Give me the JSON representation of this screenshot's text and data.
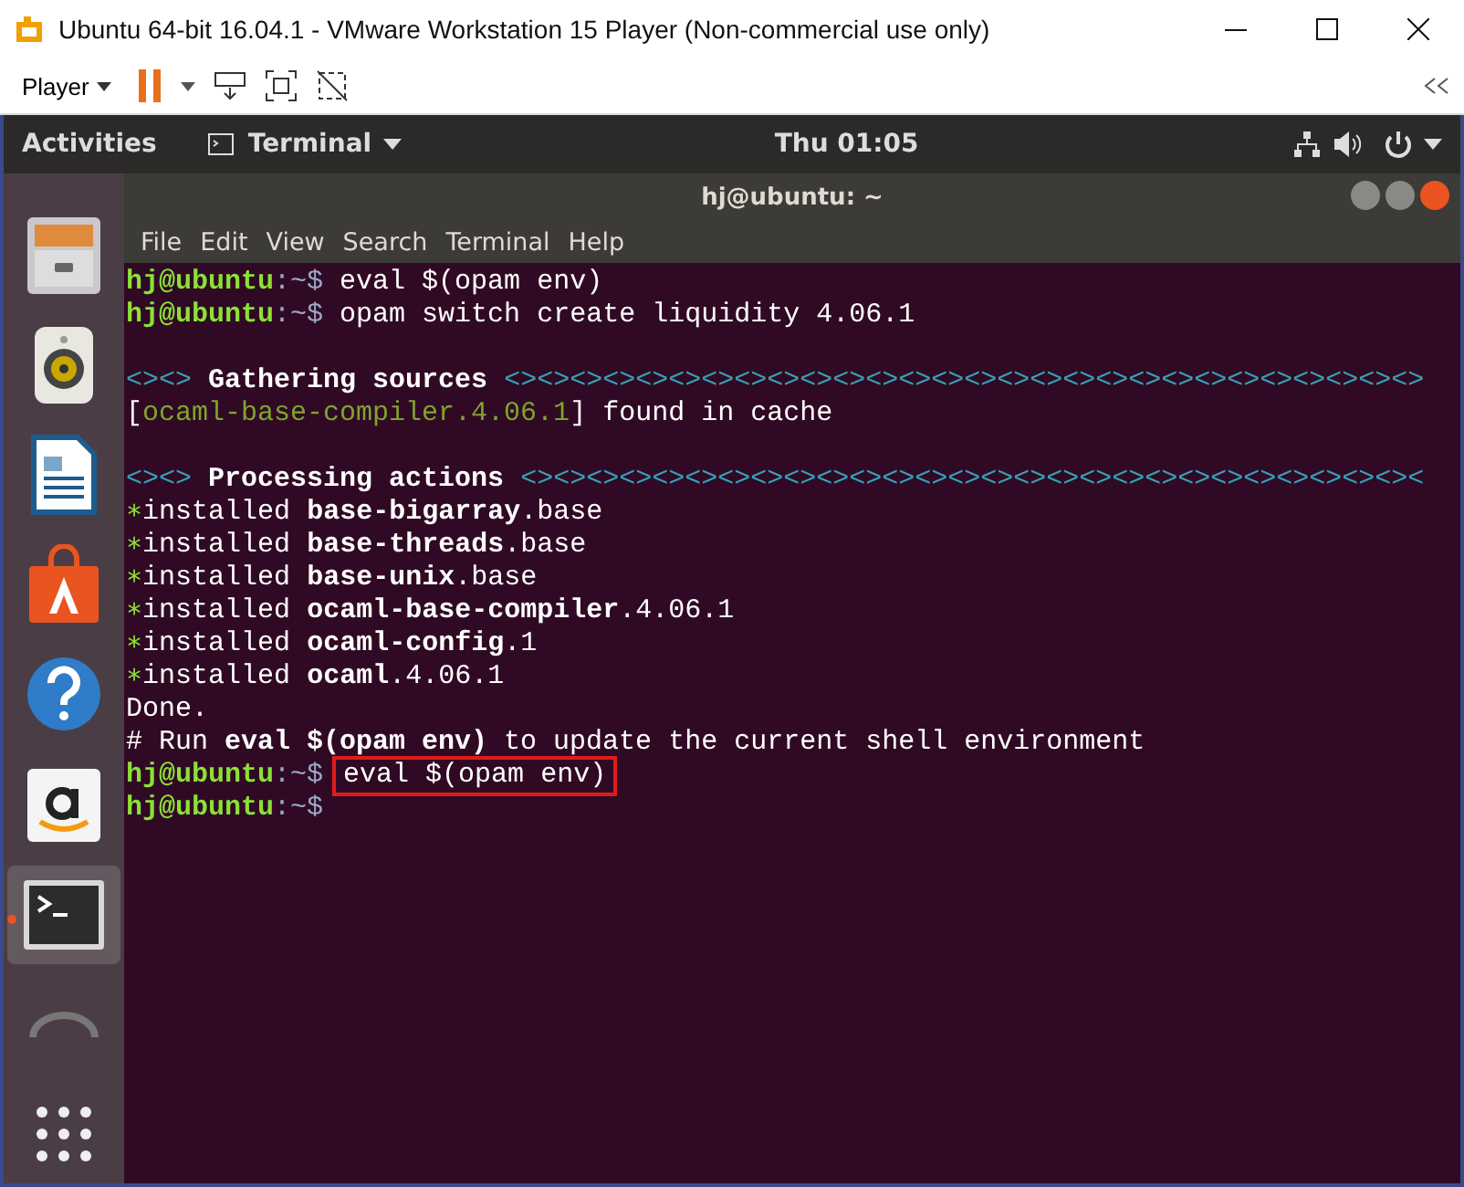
{
  "window": {
    "title": "Ubuntu 64-bit 16.04.1 - VMware Workstation 15 Player (Non-commercial use only)"
  },
  "toolbar": {
    "menu": "Player"
  },
  "topbar": {
    "activities": "Activities",
    "app": "Terminal",
    "clock": "Thu 01:05"
  },
  "dock": [
    {
      "kind": "files",
      "active": false
    },
    {
      "kind": "speaker",
      "active": false
    },
    {
      "kind": "writer",
      "active": false
    },
    {
      "kind": "software",
      "active": false
    },
    {
      "kind": "help",
      "active": false
    },
    {
      "kind": "amazon",
      "active": false
    },
    {
      "kind": "terminal",
      "active": true
    },
    {
      "kind": "partial",
      "active": false
    },
    {
      "kind": "grid",
      "active": false
    }
  ],
  "terminal": {
    "title": "hj@ubuntu: ~",
    "menu": [
      "File",
      "Edit",
      "View",
      "Search",
      "Terminal",
      "Help"
    ],
    "lines": [
      {
        "kind": "prompt",
        "user": "hj@ubuntu",
        "path": ":~$",
        "command": "eval $(opam env)",
        "highlighted": false
      },
      {
        "kind": "prompt",
        "user": "hj@ubuntu",
        "path": ":~$",
        "command": "opam switch create liquidity 4.06.1",
        "highlighted": false
      },
      {
        "kind": "blank"
      },
      {
        "kind": "banner",
        "marker": "<><>",
        "title": "Gathering sources",
        "fill": "<><><><><><><><><><><><><><><><><><><><><><><><><><><><>"
      },
      {
        "kind": "cache",
        "open": "[",
        "package": "ocaml-base-compiler.4.06.1",
        "rest": "] found in cache"
      },
      {
        "kind": "blank"
      },
      {
        "kind": "banner",
        "marker": "<><>",
        "title": "Processing actions",
        "fill": "<><><><><><><><><><><><><><><><><><><><><><><><><><><><"
      },
      {
        "kind": "installed",
        "bullet": "∗",
        "verb": "installed",
        "name": "base-bigarray",
        "suffix": ".base"
      },
      {
        "kind": "installed",
        "bullet": "∗",
        "verb": "installed",
        "name": "base-threads",
        "suffix": ".base"
      },
      {
        "kind": "installed",
        "bullet": "∗",
        "verb": "installed",
        "name": "base-unix",
        "suffix": ".base"
      },
      {
        "kind": "installed",
        "bullet": "∗",
        "verb": "installed",
        "name": "ocaml-base-compiler",
        "suffix": ".4.06.1"
      },
      {
        "kind": "installed",
        "bullet": "∗",
        "verb": "installed",
        "name": "ocaml-config",
        "suffix": ".1"
      },
      {
        "kind": "installed",
        "bullet": "∗",
        "verb": "installed",
        "name": "ocaml",
        "suffix": ".4.06.1"
      },
      {
        "kind": "plain",
        "text": "Done."
      },
      {
        "kind": "hint",
        "text": "# Run **eval $(opam env)** to update the current shell environment"
      },
      {
        "kind": "prompt",
        "user": "hj@ubuntu",
        "path": ":~$",
        "command": "eval $(opam env)",
        "highlighted": true
      },
      {
        "kind": "prompt",
        "user": "hj@ubuntu",
        "path": ":~$"
      }
    ]
  }
}
